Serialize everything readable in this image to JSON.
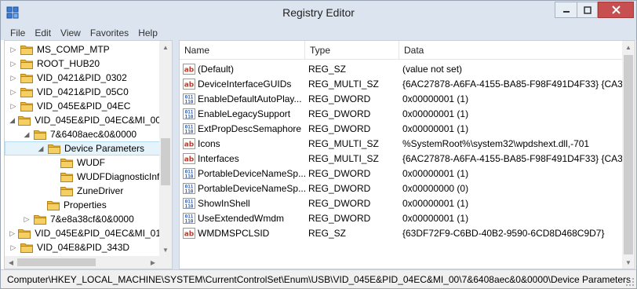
{
  "window": {
    "title": "Registry Editor"
  },
  "menu": [
    "File",
    "Edit",
    "View",
    "Favorites",
    "Help"
  ],
  "tree": [
    {
      "label": "MS_COMP_MTP",
      "indent": 0,
      "expander": "collapsed"
    },
    {
      "label": "ROOT_HUB20",
      "indent": 0,
      "expander": "collapsed"
    },
    {
      "label": "VID_0421&PID_0302",
      "indent": 0,
      "expander": "collapsed"
    },
    {
      "label": "VID_0421&PID_05C0",
      "indent": 0,
      "expander": "collapsed"
    },
    {
      "label": "VID_045E&PID_04EC",
      "indent": 0,
      "expander": "collapsed"
    },
    {
      "label": "VID_045E&PID_04EC&MI_00",
      "indent": 0,
      "expander": "expanded"
    },
    {
      "label": "7&6408aec&0&0000",
      "indent": 1,
      "expander": "expanded"
    },
    {
      "label": "Device Parameters",
      "indent": 2,
      "expander": "expanded",
      "selected": true
    },
    {
      "label": "WUDF",
      "indent": 3,
      "expander": "none"
    },
    {
      "label": "WUDFDiagnosticInf",
      "indent": 3,
      "expander": "none"
    },
    {
      "label": "ZuneDriver",
      "indent": 3,
      "expander": "none"
    },
    {
      "label": "Properties",
      "indent": 2,
      "expander": "none"
    },
    {
      "label": "7&e8a38cf&0&0000",
      "indent": 1,
      "expander": "collapsed"
    },
    {
      "label": "VID_045E&PID_04EC&MI_01",
      "indent": 0,
      "expander": "collapsed"
    },
    {
      "label": "VID_04E8&PID_343D",
      "indent": 0,
      "expander": "collapsed"
    }
  ],
  "list": {
    "columns": [
      "Name",
      "Type",
      "Data"
    ],
    "rows": [
      {
        "name": "(Default)",
        "type": "REG_SZ",
        "data": "(value not set)",
        "icon": "ab"
      },
      {
        "name": "DeviceInterfaceGUIDs",
        "type": "REG_MULTI_SZ",
        "data": "{6AC27878-A6FA-4155-BA85-F98F491D4F33} {CA3...",
        "icon": "ab"
      },
      {
        "name": "EnableDefaultAutoPlay...",
        "type": "REG_DWORD",
        "data": "0x00000001 (1)",
        "icon": "bin"
      },
      {
        "name": "EnableLegacySupport",
        "type": "REG_DWORD",
        "data": "0x00000001 (1)",
        "icon": "bin"
      },
      {
        "name": "ExtPropDescSemaphore",
        "type": "REG_DWORD",
        "data": "0x00000001 (1)",
        "icon": "bin"
      },
      {
        "name": "Icons",
        "type": "REG_MULTI_SZ",
        "data": "%SystemRoot%\\system32\\wpdshext.dll,-701",
        "icon": "ab"
      },
      {
        "name": "Interfaces",
        "type": "REG_MULTI_SZ",
        "data": "{6AC27878-A6FA-4155-BA85-F98F491D4F33} {CA3...",
        "icon": "ab"
      },
      {
        "name": "PortableDeviceNameSp...",
        "type": "REG_DWORD",
        "data": "0x00000001 (1)",
        "icon": "bin"
      },
      {
        "name": "PortableDeviceNameSp...",
        "type": "REG_DWORD",
        "data": "0x00000000 (0)",
        "icon": "bin"
      },
      {
        "name": "ShowInShell",
        "type": "REG_DWORD",
        "data": "0x00000001 (1)",
        "icon": "bin"
      },
      {
        "name": "UseExtendedWmdm",
        "type": "REG_DWORD",
        "data": "0x00000001 (1)",
        "icon": "bin"
      },
      {
        "name": "WMDMSPCLSID",
        "type": "REG_SZ",
        "data": "{63DF72F9-C6BD-40B2-9590-6CD8D468C9D7}",
        "icon": "ab"
      }
    ]
  },
  "status": {
    "path": "Computer\\HKEY_LOCAL_MACHINE\\SYSTEM\\CurrentControlSet\\Enum\\USB\\VID_045E&PID_04EC&MI_00\\7&6408aec&0&0000\\Device Parameters"
  },
  "colors": {
    "titlebar": "#dbe4ef",
    "selection": "#e5f3fb",
    "folder": "#e8b53a",
    "ab_icon": "#c0392b",
    "bin_icon": "#2a5db0"
  }
}
